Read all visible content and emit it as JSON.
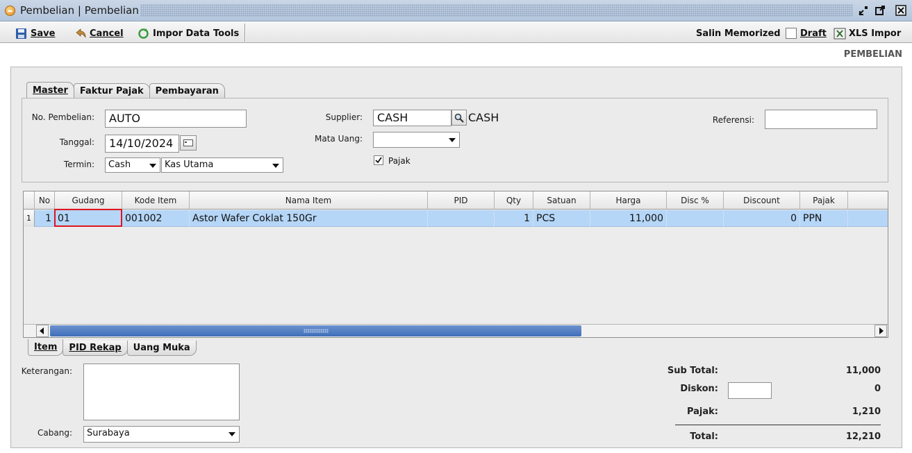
{
  "window": {
    "title": "Pembelian | Pembelian"
  },
  "toolbar": {
    "save": "Save",
    "cancel": "Cancel",
    "import_data": "Impor Data",
    "tools": "Tools",
    "salin_memorized": "Salin Memorized",
    "draft": "Draft",
    "draft_checked": false,
    "xls_import": "XLS Impor"
  },
  "section_label": "PEMBELIAN",
  "top_tabs": [
    {
      "label": "Master",
      "active": true
    },
    {
      "label": "Faktur Pajak",
      "active": false
    },
    {
      "label": "Pembayaran",
      "active": false
    }
  ],
  "master": {
    "no_pembelian_label": "No. Pembelian:",
    "no_pembelian_value": "AUTO",
    "tanggal_label": "Tanggal:",
    "tanggal_value": "14/10/2024",
    "termin_label": "Termin:",
    "termin_value": "Cash",
    "kas_value": "Kas Utama",
    "supplier_label": "Supplier:",
    "supplier_value": "CASH",
    "supplier_name": "CASH",
    "mata_uang_label": "Mata Uang:",
    "mata_uang_value": "",
    "pajak_label": "Pajak",
    "pajak_checked": true,
    "referensi_label": "Referensi:",
    "referensi_value": ""
  },
  "grid": {
    "columns": [
      "No",
      "Gudang",
      "Kode Item",
      "Nama Item",
      "PID",
      "Qty",
      "Satuan",
      "Harga",
      "Disc %",
      "Discount",
      "Pajak"
    ],
    "rows": [
      {
        "rownum": "1",
        "no": "1",
        "gudang": "01",
        "kode_item": "001002",
        "nama_item": "Astor Wafer Coklat 150Gr",
        "pid": "",
        "qty": "1",
        "satuan": "PCS",
        "harga": "11,000",
        "disc_pct": "",
        "discount": "0",
        "pajak": "PPN"
      }
    ]
  },
  "bottom_tabs": [
    {
      "label": "Item",
      "active": true
    },
    {
      "label": "PID Rekap",
      "active": false
    },
    {
      "label": "Uang Muka",
      "active": false
    }
  ],
  "footer": {
    "keterangan_label": "Keterangan:",
    "keterangan_value": "",
    "cabang_label": "Cabang:",
    "cabang_value": "Surabaya",
    "sub_total_label": "Sub Total:",
    "sub_total_value": "11,000",
    "diskon_label": "Diskon:",
    "diskon_value": "0",
    "pajak_label": "Pajak:",
    "pajak_value": "1,210",
    "total_label": "Total:",
    "total_value": "12,210"
  },
  "colors": {
    "selected_row": "#b5d6f7",
    "highlight_border": "#e0141e",
    "scroll_thumb": "#3f6fb8"
  }
}
